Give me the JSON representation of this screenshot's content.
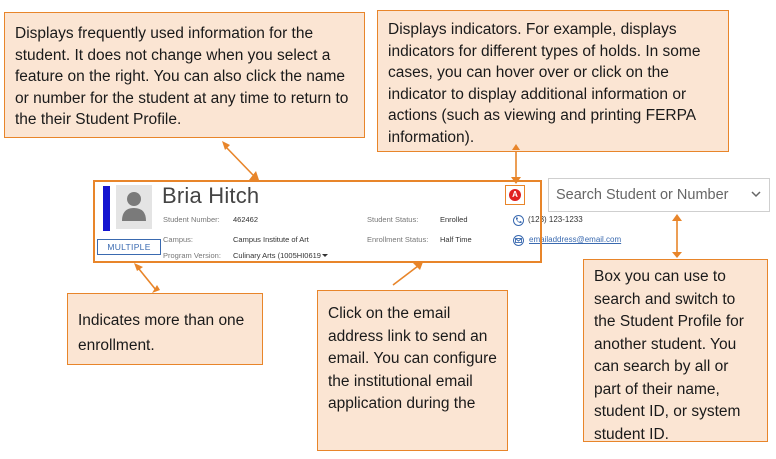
{
  "callouts": {
    "profile_header": "Displays frequently used information for the student. It does not change when you select a feature on the right. You can also click the name or number for the student at any time to return to the their Student Profile.",
    "indicators": "Displays indicators. For example, displays indicators for different types of holds. In some cases, you can hover over or click on the indicator to display additional information or actions (such as viewing and printing FERPA information).",
    "enrollment": "Indicates more than one enrollment.",
    "email": "Click on the email address link to send an email. You can configure the institutional email application during the",
    "search": "Box you can use to search and switch to the Student Profile for another student. You can search by all or part of their name, student ID, or system student ID."
  },
  "student": {
    "name": "Bria Hitch",
    "multiple_label": "MULTIPLE",
    "fields": {
      "student_number_label": "Student Number:",
      "student_number": "462462",
      "campus_label": "Campus:",
      "campus": "Campus Institute of Art",
      "program_version_label": "Program Version:",
      "program_version": "Culinary Arts (1005HI0619",
      "student_status_label": "Student Status:",
      "student_status": "Enrolled",
      "enrollment_status_label": "Enrollment Status:",
      "enrollment_status": "Half Time"
    },
    "phone": "(123) 123-1233",
    "email": "emailaddress@email.com"
  },
  "indicator": {
    "letter": "A",
    "color": "#e02020"
  },
  "search": {
    "placeholder": "Search Student or Number"
  },
  "colors": {
    "callout_fill": "#fbe5d3",
    "callout_border": "#e8852a",
    "accent_blue": "#1515d0",
    "link_blue": "#3a6ab0"
  },
  "icons": [
    "user-avatar-icon",
    "phone-icon",
    "email-icon",
    "caret-down-icon",
    "chevron-down-icon",
    "hold-indicator-icon"
  ]
}
